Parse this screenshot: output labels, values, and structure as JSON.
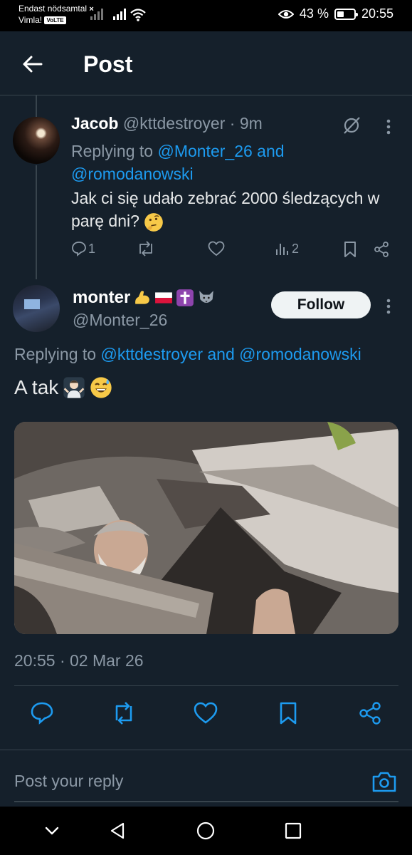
{
  "status_bar": {
    "carrier_line1": "Endast nödsamtal",
    "carrier_x": "×",
    "carrier_line2": "Vimla!",
    "volte": "VoLTE",
    "battery_percent_text": "43 %",
    "battery_level": 0.43,
    "time": "20:55"
  },
  "header": {
    "title": "Post",
    "back_icon": "arrow-left-icon"
  },
  "parent_tweet": {
    "name": "Jacob",
    "handle": "@kttdestroyer",
    "dot": "·",
    "age": "9m",
    "replying_prefix": "Replying to",
    "replying_user1": "@Monter_26",
    "replying_and": "and",
    "replying_user2": "@romodanowski",
    "text": "Jak ci się udało zebrać 2000 śledzących w parę dni?",
    "text_emoji": "thinking-face-emoji",
    "reply_count": "1",
    "retweet_count": "",
    "like_count": "",
    "view_count": "2"
  },
  "main_tweet": {
    "name": "monter",
    "name_emojis": [
      "flexed-biceps-emoji",
      "poland-flag-emoji",
      "latin-cross-emoji",
      "wolf-emoji"
    ],
    "handle": "@Monter_26",
    "follow_label": "Follow",
    "replying_prefix": "Replying to",
    "replying_user1": "@kttdestroyer",
    "replying_and": "and",
    "replying_user2": "@romodanowski",
    "text": "A tak",
    "text_emojis": [
      "person-shrugging-emoji",
      "grinning-sweat-emoji"
    ],
    "media_alt": "gif image",
    "timestamp": "20:55 · 02 Mar 26"
  },
  "reply_box": {
    "placeholder": "Post your reply"
  },
  "colors": {
    "background": "#15202b",
    "accent": "#1d9bf0",
    "muted": "#8b98a5",
    "divider": "#38444d"
  }
}
